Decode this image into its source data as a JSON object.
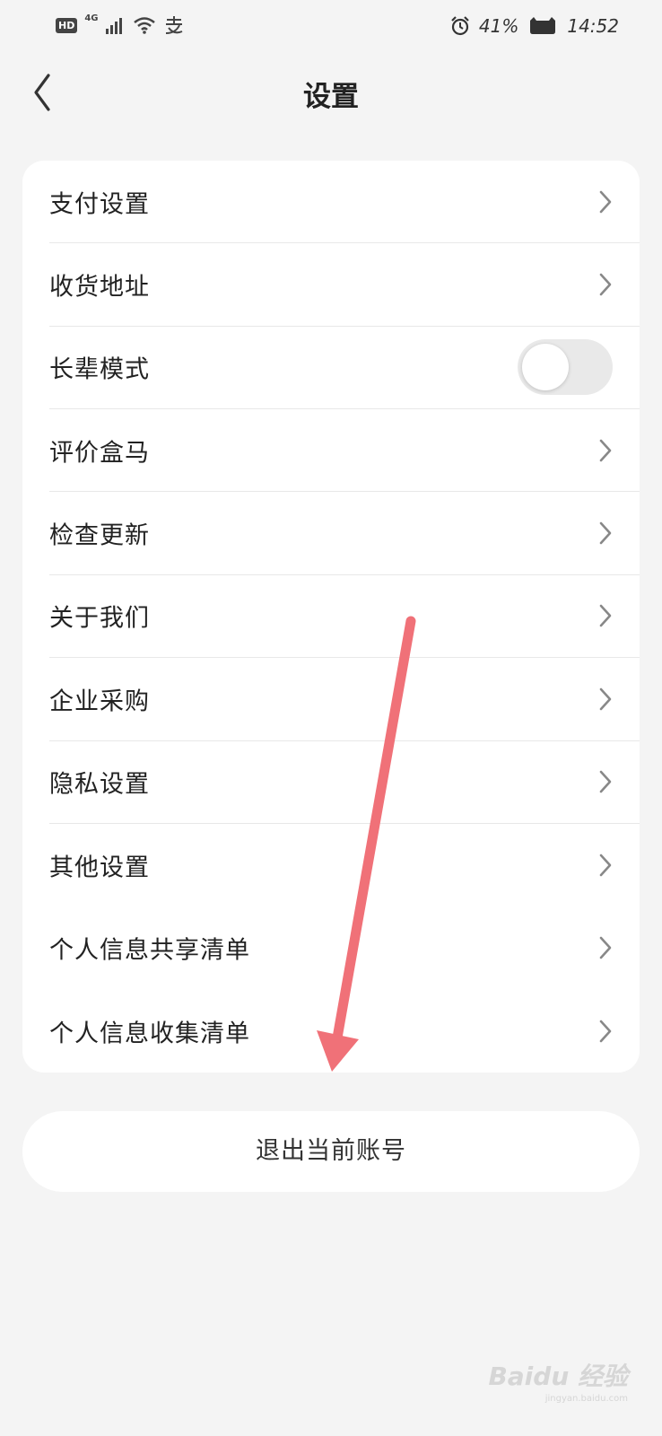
{
  "status_bar": {
    "hd": "HD",
    "network": "4G",
    "battery": "41%",
    "time": "14:52"
  },
  "header": {
    "title": "设置"
  },
  "settings": {
    "items": [
      {
        "label": "支付设置",
        "type": "link"
      },
      {
        "label": "收货地址",
        "type": "link"
      },
      {
        "label": "长辈模式",
        "type": "toggle",
        "toggle_on": false
      },
      {
        "label": "评价盒马",
        "type": "link"
      },
      {
        "label": "检查更新",
        "type": "link"
      },
      {
        "label": "关于我们",
        "type": "link"
      },
      {
        "label": "企业采购",
        "type": "link"
      },
      {
        "label": "隐私设置",
        "type": "link"
      },
      {
        "label": "其他设置",
        "type": "link"
      },
      {
        "label": "个人信息共享清单",
        "type": "link"
      },
      {
        "label": "个人信息收集清单",
        "type": "link"
      }
    ]
  },
  "logout": {
    "label": "退出当前账号"
  },
  "watermark": {
    "brand": "Baidu 经验",
    "url": "jingyan.baidu.com"
  },
  "colors": {
    "background": "#f4f4f4",
    "card": "#ffffff",
    "annotation_arrow": "#f07178",
    "toggle_off": "#e9e9e9"
  }
}
